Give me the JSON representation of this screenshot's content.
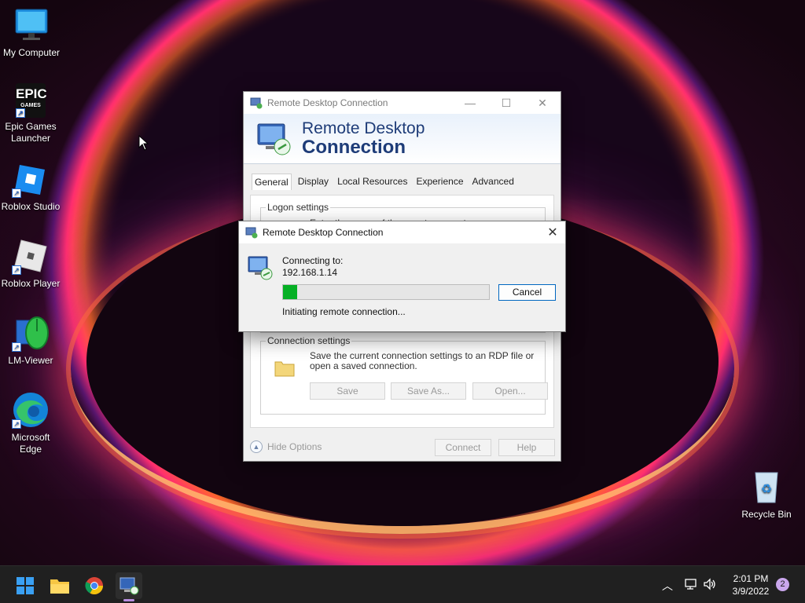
{
  "desktop_icons": [
    {
      "label_1": "My Computer",
      "label_2": ""
    },
    {
      "label_1": "Epic Games",
      "label_2": "Launcher"
    },
    {
      "label_1": "Roblox Studio",
      "label_2": ""
    },
    {
      "label_1": "Roblox Player",
      "label_2": ""
    },
    {
      "label_1": "LM-Viewer",
      "label_2": ""
    },
    {
      "label_1": "Microsoft",
      "label_2": "Edge"
    },
    {
      "label_1": "Recycle Bin",
      "label_2": ""
    }
  ],
  "epic_logo": {
    "line1": "EPIC",
    "line2": "GAMES"
  },
  "rdp_window": {
    "title": "Remote Desktop Connection",
    "banner_line1": "Remote Desktop",
    "banner_line2": "Connection",
    "tabs": [
      "General",
      "Display",
      "Local Resources",
      "Experience",
      "Advanced"
    ],
    "active_tab": "General",
    "logon_settings_label": "Logon settings",
    "logon_hint": "Enter the name of the remote computer.",
    "connection_settings_label": "Connection settings",
    "connection_settings_text": "Save the current connection settings to an RDP file or open a saved connection.",
    "save_label": "Save",
    "save_as_label": "Save As...",
    "open_label": "Open...",
    "hide_options_label": "Hide Options",
    "connect_label": "Connect",
    "help_label": "Help"
  },
  "connecting_dialog": {
    "title": "Remote Desktop Connection",
    "connecting_to_label": "Connecting to:",
    "address": "192.168.1.14",
    "progress_fraction": 0.07,
    "status": "Initiating remote connection...",
    "cancel_label": "Cancel"
  },
  "taskbar": {
    "pinned": [
      "start-icon",
      "file-explorer-icon",
      "chrome-icon",
      "remote-desktop-icon"
    ],
    "time": "2:01 PM",
    "date": "3/9/2022",
    "notification_count": "2"
  },
  "colors": {
    "progress_green": "#06b025",
    "accent_blue": "#0067c0",
    "banner_text": "#1e3c78"
  }
}
